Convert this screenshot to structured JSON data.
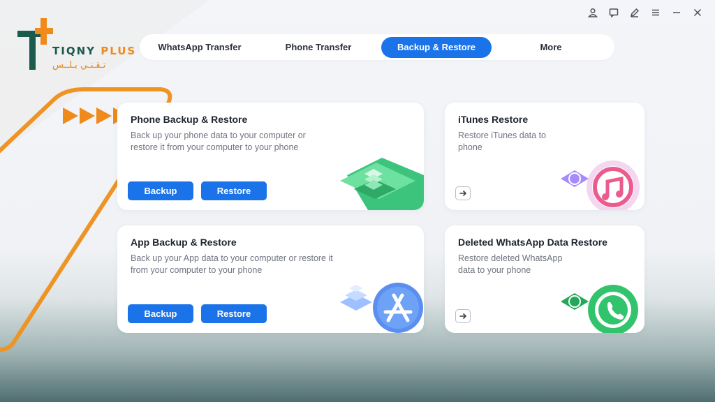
{
  "brand": {
    "name": "TIQNY",
    "plus": "PLUS",
    "arabic": "تـقـنـي بـلــس"
  },
  "nav": {
    "tabs": [
      {
        "label": "WhatsApp Transfer"
      },
      {
        "label": "Phone Transfer"
      },
      {
        "label": "Backup & Restore"
      },
      {
        "label": "More"
      }
    ],
    "active": "Backup & Restore"
  },
  "window_controls": [
    "user-icon",
    "message-icon",
    "edit-icon",
    "menu-icon",
    "minimize-icon",
    "close-icon"
  ],
  "cards": {
    "phone": {
      "title": "Phone Backup & Restore",
      "desc": "Back up your phone data to your computer or restore it from your computer to your phone",
      "backup": "Backup",
      "restore": "Restore"
    },
    "itunes": {
      "title": "iTunes Restore",
      "desc": "Restore iTunes data to phone"
    },
    "app": {
      "title": "App Backup & Restore",
      "desc": "Back up your App data to your computer or restore it from your computer to your phone",
      "backup": "Backup",
      "restore": "Restore"
    },
    "whatsapp": {
      "title": "Deleted WhatsApp Data Restore",
      "desc": "Restore deleted WhatsApp data to your phone"
    }
  },
  "colors": {
    "accent": "#1a73e8",
    "brand_green": "#1b5a4c",
    "brand_orange": "#ef8a1b"
  }
}
